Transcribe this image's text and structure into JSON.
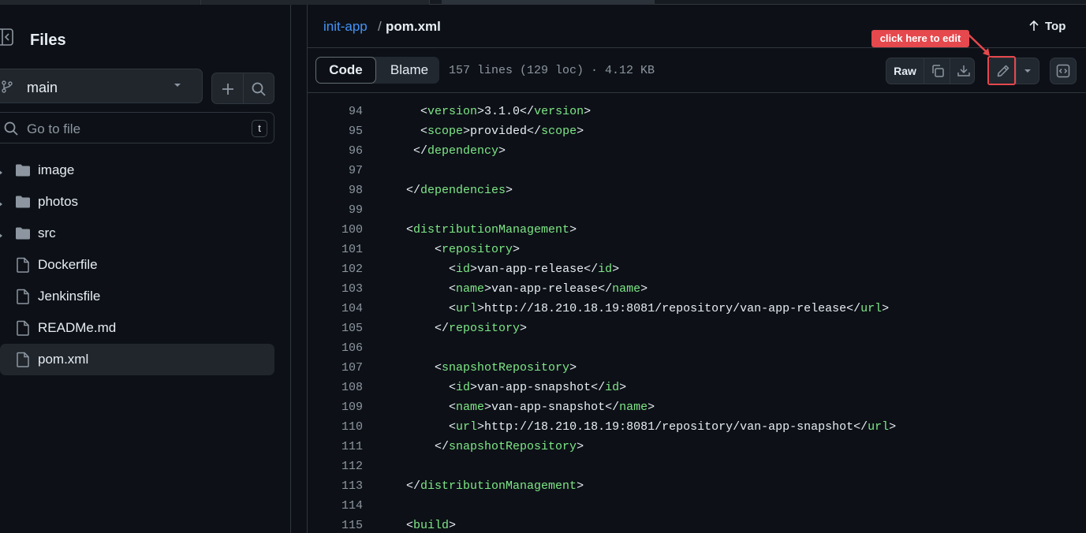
{
  "sidebar": {
    "title": "Files",
    "branch": "main",
    "goto_placeholder": "Go to file",
    "goto_shortcut": "t",
    "items": [
      {
        "label": "image",
        "type": "folder"
      },
      {
        "label": "photos",
        "type": "folder"
      },
      {
        "label": "src",
        "type": "folder"
      },
      {
        "label": "Dockerfile",
        "type": "file"
      },
      {
        "label": "Jenkinsfile",
        "type": "file"
      },
      {
        "label": "READMe.md",
        "type": "file"
      },
      {
        "label": "pom.xml",
        "type": "file",
        "selected": true
      }
    ]
  },
  "header": {
    "repo": "init-app",
    "separator": "/",
    "file": "pom.xml",
    "top_label": "Top"
  },
  "toolbar": {
    "code_label": "Code",
    "blame_label": "Blame",
    "meta": "157 lines (129 loc) · 4.12 KB",
    "raw_label": "Raw",
    "callout": "click here to edit"
  },
  "code": {
    "lines": [
      {
        "n": "94",
        "indent": 2,
        "parts": [
          [
            "p",
            "<"
          ],
          [
            "t",
            "version"
          ],
          [
            "p",
            ">3.1.0</"
          ],
          [
            "t",
            "version"
          ],
          [
            "p",
            ">"
          ]
        ]
      },
      {
        "n": "95",
        "indent": 2,
        "parts": [
          [
            "p",
            "<"
          ],
          [
            "t",
            "scope"
          ],
          [
            "p",
            ">provided</"
          ],
          [
            "t",
            "scope"
          ],
          [
            "p",
            ">"
          ]
        ]
      },
      {
        "n": "96",
        "indent": 1,
        "parts": [
          [
            "p",
            "</"
          ],
          [
            "t",
            "dependency"
          ],
          [
            "p",
            ">"
          ]
        ]
      },
      {
        "n": "97",
        "indent": 0,
        "parts": []
      },
      {
        "n": "98",
        "indent": 0,
        "parts": [
          [
            "p",
            "</"
          ],
          [
            "t",
            "dependencies"
          ],
          [
            "p",
            ">"
          ]
        ]
      },
      {
        "n": "99",
        "indent": 0,
        "parts": []
      },
      {
        "n": "100",
        "indent": 0,
        "parts": [
          [
            "p",
            "<"
          ],
          [
            "t",
            "distributionManagement"
          ],
          [
            "p",
            ">"
          ]
        ]
      },
      {
        "n": "101",
        "indent": 4,
        "parts": [
          [
            "p",
            "<"
          ],
          [
            "t",
            "repository"
          ],
          [
            "p",
            ">"
          ]
        ]
      },
      {
        "n": "102",
        "indent": 6,
        "parts": [
          [
            "p",
            "<"
          ],
          [
            "t",
            "id"
          ],
          [
            "p",
            ">van-app-release</"
          ],
          [
            "t",
            "id"
          ],
          [
            "p",
            ">"
          ]
        ]
      },
      {
        "n": "103",
        "indent": 6,
        "parts": [
          [
            "p",
            "<"
          ],
          [
            "t",
            "name"
          ],
          [
            "p",
            ">van-app-release</"
          ],
          [
            "t",
            "name"
          ],
          [
            "p",
            ">"
          ]
        ]
      },
      {
        "n": "104",
        "indent": 6,
        "parts": [
          [
            "p",
            "<"
          ],
          [
            "t",
            "url"
          ],
          [
            "p",
            ">http://18.210.18.19:8081/repository/van-app-release</"
          ],
          [
            "t",
            "url"
          ],
          [
            "p",
            ">"
          ]
        ]
      },
      {
        "n": "105",
        "indent": 4,
        "parts": [
          [
            "p",
            "</"
          ],
          [
            "t",
            "repository"
          ],
          [
            "p",
            ">"
          ]
        ]
      },
      {
        "n": "106",
        "indent": 0,
        "parts": []
      },
      {
        "n": "107",
        "indent": 4,
        "parts": [
          [
            "p",
            "<"
          ],
          [
            "t",
            "snapshotRepository"
          ],
          [
            "p",
            ">"
          ]
        ]
      },
      {
        "n": "108",
        "indent": 6,
        "parts": [
          [
            "p",
            "<"
          ],
          [
            "t",
            "id"
          ],
          [
            "p",
            ">van-app-snapshot</"
          ],
          [
            "t",
            "id"
          ],
          [
            "p",
            ">"
          ]
        ]
      },
      {
        "n": "109",
        "indent": 6,
        "parts": [
          [
            "p",
            "<"
          ],
          [
            "t",
            "name"
          ],
          [
            "p",
            ">van-app-snapshot</"
          ],
          [
            "t",
            "name"
          ],
          [
            "p",
            ">"
          ]
        ]
      },
      {
        "n": "110",
        "indent": 6,
        "parts": [
          [
            "p",
            "<"
          ],
          [
            "t",
            "url"
          ],
          [
            "p",
            ">http://18.210.18.19:8081/repository/van-app-snapshot</"
          ],
          [
            "t",
            "url"
          ],
          [
            "p",
            ">"
          ]
        ]
      },
      {
        "n": "111",
        "indent": 4,
        "parts": [
          [
            "p",
            "</"
          ],
          [
            "t",
            "snapshotRepository"
          ],
          [
            "p",
            ">"
          ]
        ]
      },
      {
        "n": "112",
        "indent": 0,
        "parts": []
      },
      {
        "n": "113",
        "indent": 0,
        "parts": [
          [
            "p",
            "</"
          ],
          [
            "t",
            "distributionManagement"
          ],
          [
            "p",
            ">"
          ]
        ]
      },
      {
        "n": "114",
        "indent": 0,
        "parts": []
      },
      {
        "n": "115",
        "indent": 0,
        "parts": [
          [
            "p",
            "<"
          ],
          [
            "t",
            "build"
          ],
          [
            "p",
            ">"
          ]
        ]
      }
    ]
  },
  "colors": {
    "background": "#0d1117",
    "link": "#4493f8",
    "tag": "#7ee787",
    "callout": "#e5484d"
  }
}
